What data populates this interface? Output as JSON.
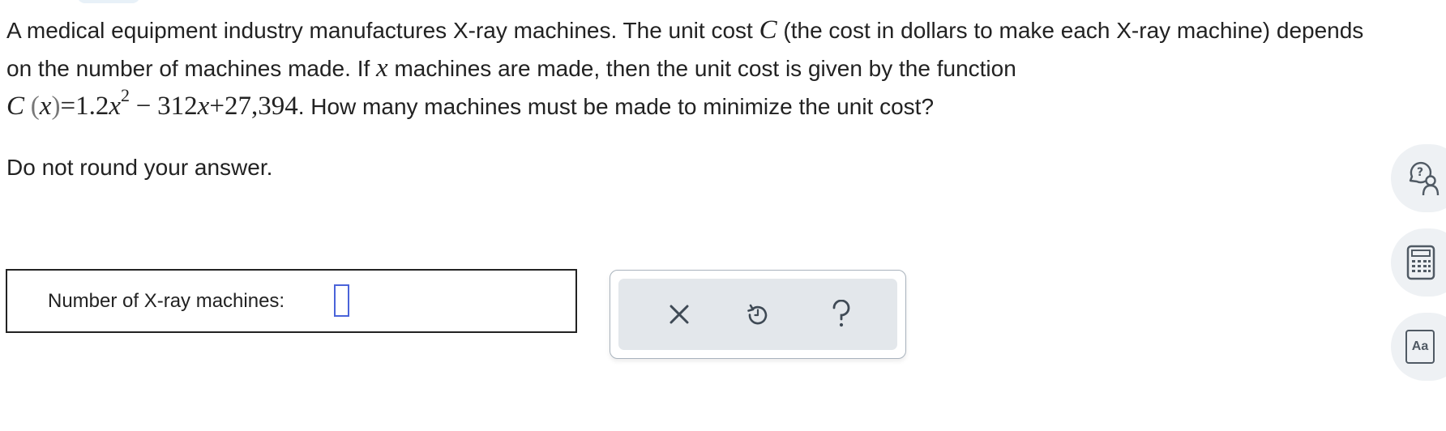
{
  "question": {
    "text_before_C": "A medical equipment industry manufactures X-ray machines. The unit cost ",
    "var_C": "C",
    "text_after_C": " (the cost in dollars to make each X-ray machine) depends on the number of machines made. If ",
    "var_x": "x",
    "text_after_x": " machines are made, then the unit cost is given by the function",
    "function": {
      "name": "C",
      "lparen": "(",
      "arg": "x",
      "rparen": ")",
      "eq": "=",
      "coef_a": "1.2",
      "var_a": "x",
      "exp": "2",
      "minus": "−",
      "coef_b": "312",
      "var_b": "x",
      "plus": "+",
      "const": "27,394"
    },
    "ending": ". How many machines must be made to minimize the unit cost?"
  },
  "instruction": "Do not round your answer.",
  "answer": {
    "label": "Number of X-ray machines:",
    "value": ""
  },
  "tools": [
    "clear-icon",
    "undo-icon",
    "help-icon"
  ],
  "side_tools": [
    "ask-tutor-icon",
    "calculator-icon",
    "dictionary-icon"
  ],
  "side_dictionary_label": "Aa",
  "colors": {
    "accent": "#4a63d9",
    "tool_icon": "#3f4a55",
    "tools_bg": "#e3e7eb",
    "side_bg": "#eef1f4"
  }
}
